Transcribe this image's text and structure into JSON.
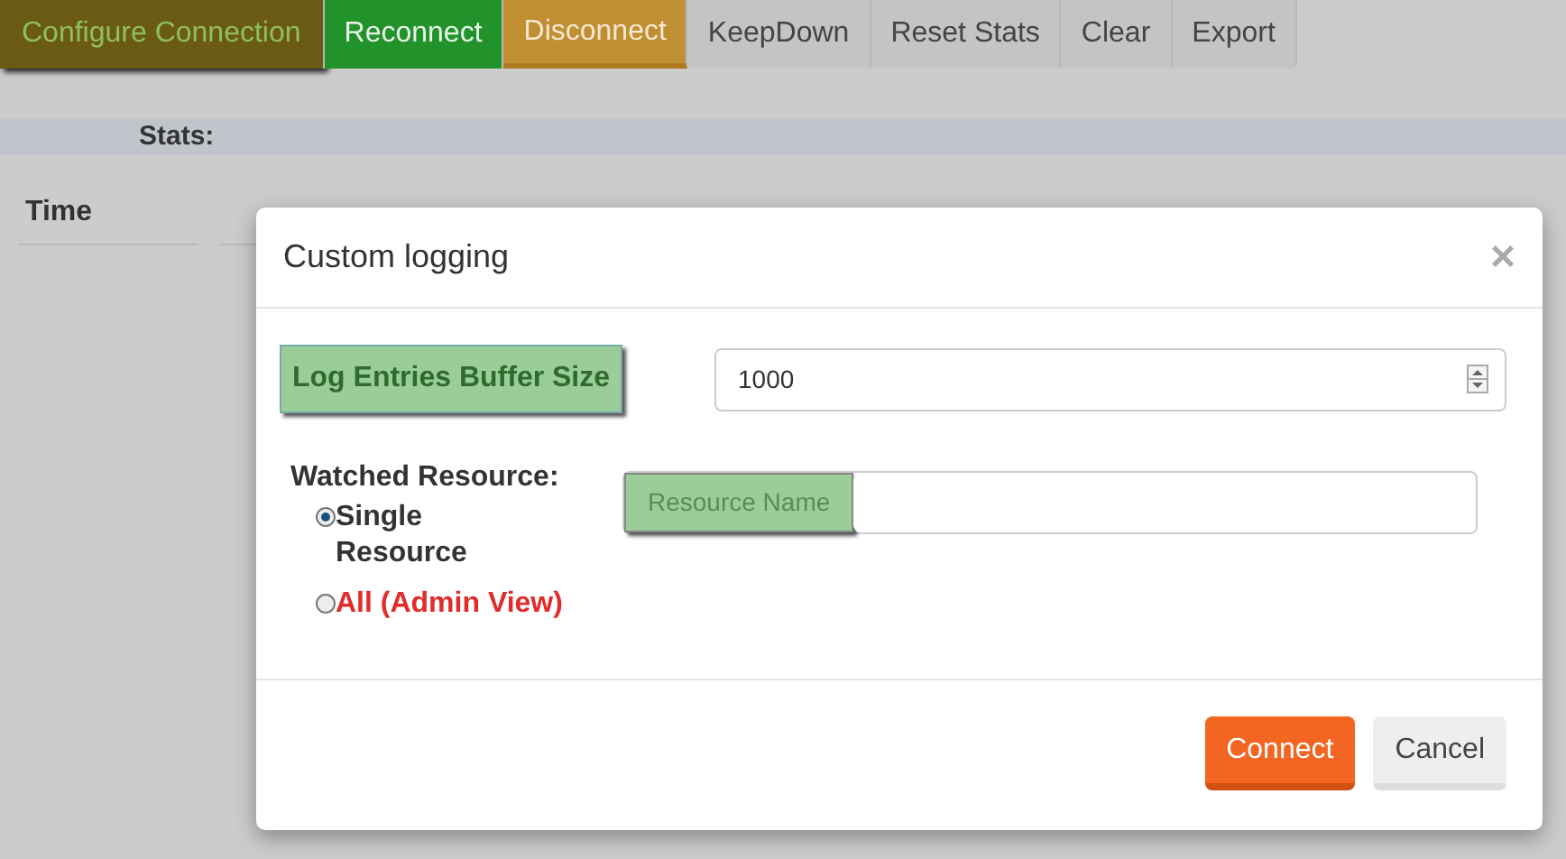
{
  "toolbar": [
    {
      "label": "Configure Connection",
      "kind": "configure"
    },
    {
      "label": "Reconnect",
      "kind": "success"
    },
    {
      "label": "Disconnect",
      "kind": "warning"
    },
    {
      "label": "KeepDown",
      "kind": "plain"
    },
    {
      "label": "Reset Stats",
      "kind": "plain"
    },
    {
      "label": "Clear",
      "kind": "plain"
    },
    {
      "label": "Export",
      "kind": "plain"
    }
  ],
  "stats": {
    "label": "Stats:"
  },
  "table": {
    "columns": [
      "Time"
    ]
  },
  "modal": {
    "title": "Custom logging",
    "close": "×",
    "buffer": {
      "label": "Log Entries Buffer Size",
      "value": "1000"
    },
    "watched": {
      "label": "Watched Resource:",
      "options": [
        {
          "label": "Single Resource",
          "selected": true,
          "kind": "normal"
        },
        {
          "label": "All (Admin View)",
          "selected": false,
          "kind": "danger"
        }
      ]
    },
    "resource": {
      "addon": "Resource Name"
    },
    "buttons": [
      {
        "label": "Connect",
        "kind": "primary"
      },
      {
        "label": "Cancel",
        "kind": "secondary"
      }
    ]
  }
}
